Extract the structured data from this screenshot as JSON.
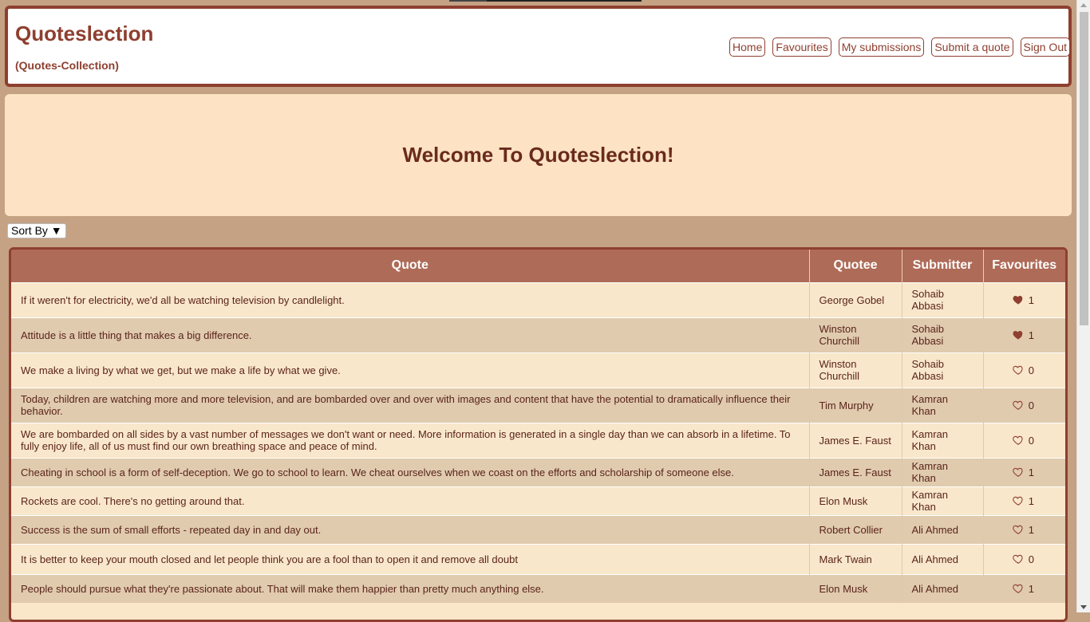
{
  "header": {
    "brand": "Quoteslection",
    "subtitle": "(Quotes-Collection)",
    "nav": [
      "Home",
      "Favourites",
      "My submissions",
      "Submit a quote",
      "Sign Out"
    ]
  },
  "hero": {
    "title": "Welcome To Quoteslection!"
  },
  "sort": {
    "label": "Sort By ▼"
  },
  "table": {
    "columns": [
      "Quote",
      "Quotee",
      "Submitter",
      "Favourites"
    ],
    "rows": [
      {
        "quote": "If it weren't for electricity, we'd all be watching television by candlelight.",
        "quotee": "George Gobel",
        "submitter": "Sohaib Abbasi",
        "favourited": true,
        "count": "1"
      },
      {
        "quote": "Attitude is a little thing that makes a big difference.",
        "quotee": "Winston Churchill",
        "submitter": "Sohaib Abbasi",
        "favourited": true,
        "count": "1"
      },
      {
        "quote": "We make a living by what we get, but we make a life by what we give.",
        "quotee": "Winston Churchill",
        "submitter": "Sohaib Abbasi",
        "favourited": false,
        "count": "0"
      },
      {
        "quote": "Today, children are watching more and more television, and are bombarded over and over with images and content that have the potential to dramatically influence their behavior.",
        "quotee": "Tim Murphy",
        "submitter": "Kamran Khan",
        "favourited": false,
        "count": "0"
      },
      {
        "quote": "We are bombarded on all sides by a vast number of messages we don't want or need. More information is generated in a single day than we can absorb in a lifetime. To fully enjoy life, all of us must find our own breathing space and peace of mind.",
        "quotee": "James E. Faust",
        "submitter": "Kamran Khan",
        "favourited": false,
        "count": "0"
      },
      {
        "quote": "Cheating in school is a form of self-deception. We go to school to learn. We cheat ourselves when we coast on the efforts and scholarship of someone else.",
        "quotee": "James E. Faust",
        "submitter": "Kamran Khan",
        "favourited": false,
        "count": "1"
      },
      {
        "quote": "Rockets are cool. There's no getting around that.",
        "quotee": "Elon Musk",
        "submitter": "Kamran Khan",
        "favourited": false,
        "count": "1"
      },
      {
        "quote": "Success is the sum of small efforts - repeated day in and day out.",
        "quotee": "Robert Collier",
        "submitter": "Ali Ahmed",
        "favourited": false,
        "count": "1"
      },
      {
        "quote": "It is better to keep your mouth closed and let people think you are a fool than to open it and remove all doubt",
        "quotee": "Mark Twain",
        "submitter": "Ali Ahmed",
        "favourited": false,
        "count": "0"
      },
      {
        "quote": "People should pursue what they're passionate about. That will make them happier than pretty much anything else.",
        "quotee": "Elon Musk",
        "submitter": "Ali Ahmed",
        "favourited": false,
        "count": "1"
      }
    ]
  },
  "colors": {
    "accent": "#8e3f2f",
    "header_bg": "#ae6b57",
    "page_bg": "#c4a283",
    "hero_bg": "#fde3c3"
  },
  "icons": {
    "favourite": "heart-icon"
  }
}
